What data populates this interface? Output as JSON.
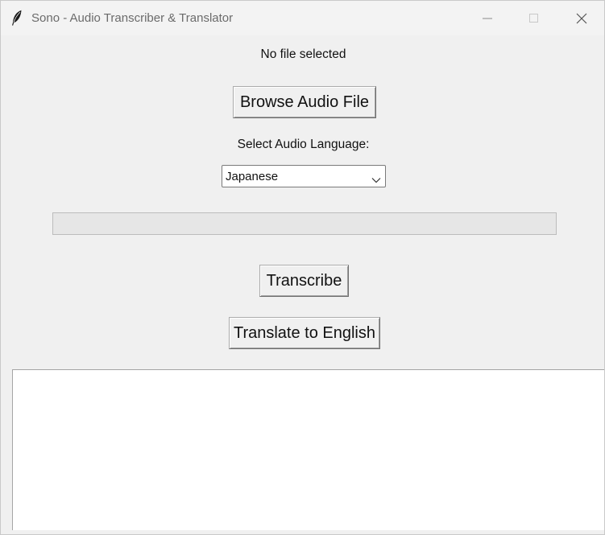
{
  "window": {
    "title": "Sono - Audio Transcriber & Translator"
  },
  "file": {
    "status": "No file selected",
    "browse_label": "Browse Audio File"
  },
  "language": {
    "label": "Select Audio Language:",
    "selected": "Japanese"
  },
  "progress": {
    "value": 0
  },
  "actions": {
    "transcribe_label": "Transcribe",
    "translate_label": "Translate to English"
  },
  "output": {
    "text": ""
  },
  "icons": {
    "app": "feather-icon",
    "minimize": "minimize-icon",
    "maximize": "maximize-icon",
    "close": "close-icon",
    "dropdown": "chevron-down-icon"
  },
  "colors": {
    "window_bg": "#f0f0f0",
    "titlebar_bg": "#f3f3f3",
    "textbox_bg": "#ffffff",
    "progress_trough": "#e6e6e6"
  }
}
